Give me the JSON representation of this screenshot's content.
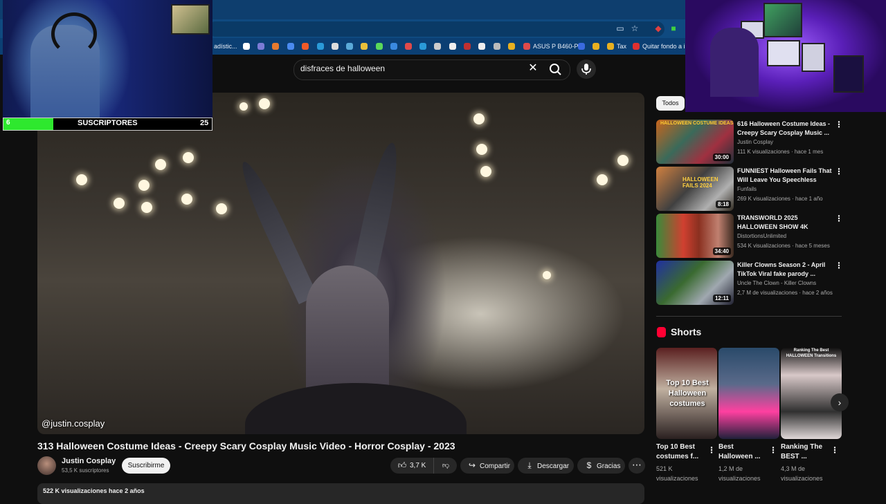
{
  "browser": {
    "bookmarks": [
      {
        "label": "adístic..."
      },
      {
        "label": "ASUS P B460-P"
      },
      {
        "label": "Tax"
      },
      {
        "label": "Quitar fondo a im"
      }
    ]
  },
  "search": {
    "query": "disfraces de halloween"
  },
  "overlay": {
    "subscribers_label": "SUSCRIPTORES",
    "current": "6",
    "goal": "25",
    "progress_fraction": 0.24
  },
  "video": {
    "watermark": "@justin.cosplay",
    "title": "313 Halloween Costume Ideas - Creepy Scary Cosplay Music Video - Horror Cosplay - 2023",
    "channel": "Justin Cosplay",
    "subscribers": "53,5 K suscriptores",
    "subscribe_label": "Suscribirme",
    "likes": "3,7 K",
    "share_label": "Compartir",
    "download_label": "Descargar",
    "thanks_label": "Gracias",
    "views_date": "522 K visualizaciones  hace 2 años"
  },
  "sidebar": {
    "chip_all": "Todos",
    "recommendations": [
      {
        "title": "616 Halloween Costume Ideas - Creepy Scary Cosplay Music ...",
        "channel": "Justin Cosplay",
        "meta": "111 K visualizaciones · hace 1 mes",
        "duration": "30:00",
        "thumb_text": "HALLOWEEN COSTUME IDEAS"
      },
      {
        "title": "FUNNIEST Halloween Fails That Will Leave You Speechless",
        "channel": "Funfails",
        "meta": "269 K visualizaciones · hace 1 año",
        "duration": "8:18",
        "thumb_text": "HALLOWEEN FAILS 2024"
      },
      {
        "title": "TRANSWORLD 2025 HALLOWEEN SHOW 4K",
        "channel": "DistortionsUnlimited",
        "meta": "534 K visualizaciones · hace 5 meses",
        "duration": "34:40",
        "thumb_text": ""
      },
      {
        "title": "Killer Clowns Season 2 - April TikTok Viral fake parody ...",
        "channel": "Uncle The Clown - Killer Clowns",
        "meta": "2,7 M de visualizaciones · hace 2 años",
        "duration": "12:11",
        "thumb_text": ""
      }
    ],
    "shorts_title": "Shorts",
    "shorts": [
      {
        "thumb_text": "Top 10 Best Halloween costumes",
        "title": "Top 10 Best costumes f...",
        "views": "521 K visualizaciones"
      },
      {
        "thumb_text": "",
        "title": "Best Halloween ...",
        "views": "1,2 M de visualizaciones"
      },
      {
        "thumb_text": "Ranking The Best HALLOWEEN Transitions",
        "title": "Ranking The BEST ...",
        "views": "4,3 M de visualizaciones"
      }
    ]
  },
  "colors": {
    "accent": "#ff0033",
    "progress": "#2ee82e",
    "chrome": "#0f4a80"
  }
}
